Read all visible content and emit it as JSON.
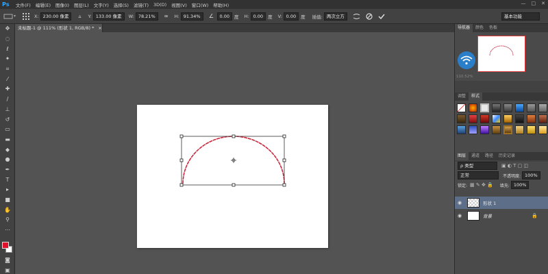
{
  "app": {
    "logo": "Ps"
  },
  "menu": [
    "文件(F)",
    "编辑(E)",
    "图像(I)",
    "图层(L)",
    "文字(Y)",
    "选择(S)",
    "滤镜(T)",
    "3D(D)",
    "视图(V)",
    "窗口(W)",
    "帮助(H)"
  ],
  "window_controls": {
    "minimize": "—",
    "maximize": "□",
    "close": "✕"
  },
  "options": {
    "x_label": "X:",
    "x_value": "230.00 像素",
    "y_label": "Y:",
    "y_value": "133.00 像素",
    "w_label": "W:",
    "w_value": "78.21%",
    "h_label": "H:",
    "h_value": "91.34%",
    "angle_value": "0.00",
    "angle_unit": "度",
    "hskew_label": "H:",
    "hskew_value": "0.00",
    "hskew_unit": "度",
    "vskew_label": "V:",
    "vskew_value": "0.00",
    "vskew_unit": "度",
    "interp_label": "插值:",
    "interp_value": "两次立方",
    "workspace": "基本功能"
  },
  "document": {
    "tab_title": "未标题-1 @ 111% (形状 1, RGB/8) *"
  },
  "colors": {
    "foreground": "#e0102c",
    "background": "#ffffff",
    "accent": "#31a8ff",
    "shape_stroke": "#c8283c"
  },
  "navigator": {
    "tabs": [
      "导航器",
      "颜色",
      "色板"
    ],
    "zoom": "110.52%"
  },
  "styles": {
    "tabs": [
      "调整",
      "样式"
    ]
  },
  "layers": {
    "tabs": [
      "图层",
      "通道",
      "路径",
      "历史记录"
    ],
    "filter_label": "ρ 类型",
    "blend_mode": "正常",
    "opacity_label": "不透明度:",
    "opacity_value": "100%",
    "lock_label": "锁定:",
    "fill_label": "填充:",
    "fill_value": "100%",
    "items": [
      {
        "name": "形状 1"
      },
      {
        "name": "背景"
      }
    ]
  }
}
